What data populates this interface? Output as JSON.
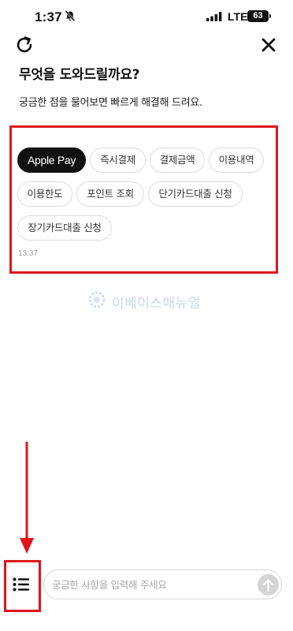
{
  "status_bar": {
    "time": "1:37",
    "network": "LTE",
    "battery_level": "63",
    "icons": [
      "bell-slash-icon",
      "signal-bars-icon",
      "battery-icon"
    ]
  },
  "header": {
    "icons": [
      "refresh-icon",
      "close-icon"
    ],
    "title": "무엇을 도와드릴까요?",
    "subtitle": "궁금한 점을 물어보면 빠르게 해결해 드려요."
  },
  "quick_replies": {
    "chips": [
      {
        "label": "Apple Pay",
        "selected": true
      },
      {
        "label": "즉시결제",
        "selected": false
      },
      {
        "label": "결제금액",
        "selected": false
      },
      {
        "label": "이용내역",
        "selected": false
      },
      {
        "label": "이용한도",
        "selected": false
      },
      {
        "label": "포인트 조회",
        "selected": false
      },
      {
        "label": "단기카드대출 신청",
        "selected": false
      },
      {
        "label": "장기카드대출 신청",
        "selected": false
      }
    ],
    "timestamp": "13:37"
  },
  "watermark": {
    "text": "이베이스매뉴얼"
  },
  "composer": {
    "menu_icon": "list-icon",
    "placeholder": "궁금한 사항을 입력해 주세요",
    "value": "",
    "send_icon": "arrow-up-icon"
  },
  "colors": {
    "annotation_red": "#e0141b",
    "chip_selected_bg": "#111111",
    "send_button_bg": "#d4d4d4",
    "watermark": "#c9d6f0"
  }
}
